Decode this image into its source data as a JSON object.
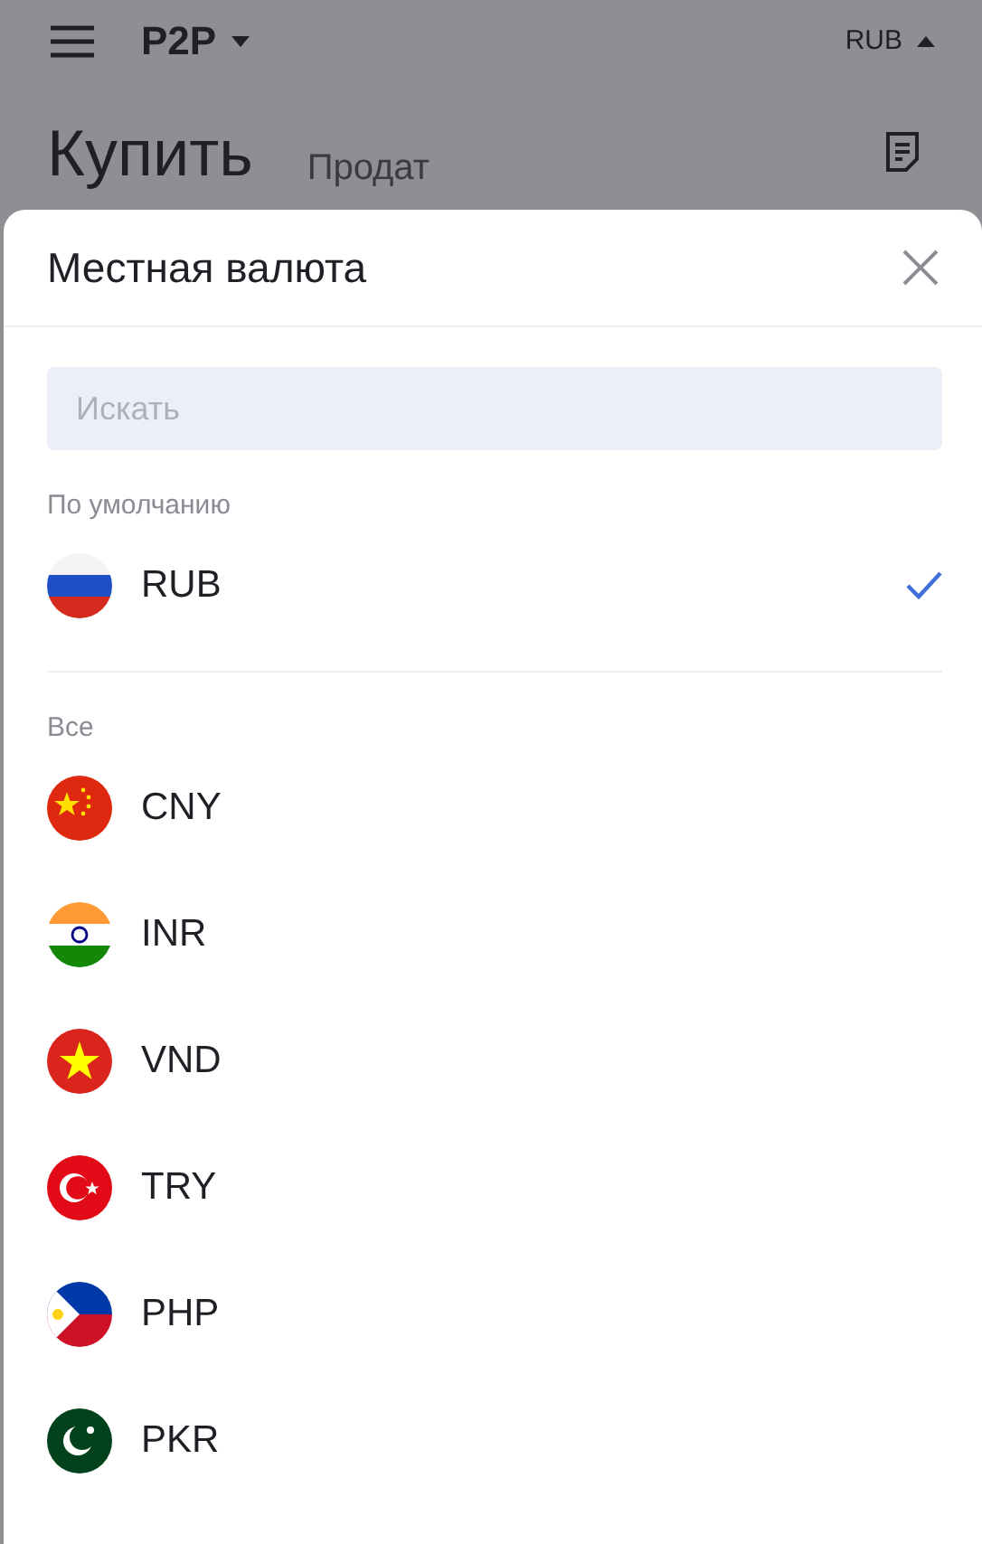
{
  "top_bar": {
    "title": "P2P",
    "currency": "RUB"
  },
  "page": {
    "tabs": [
      {
        "label": "Купить",
        "selected": true
      },
      {
        "label": "Продат",
        "selected": false
      }
    ]
  },
  "sheet": {
    "title": "Местная валюта",
    "search": {
      "placeholder": "Искать"
    },
    "sections": [
      {
        "title": "По умолчанию",
        "items": [
          {
            "code": "RUB",
            "kind": "russia",
            "selected": true
          }
        ]
      },
      {
        "title": "Все",
        "items": [
          {
            "code": "CNY",
            "kind": "china",
            "selected": false
          },
          {
            "code": "INR",
            "kind": "india",
            "selected": false
          },
          {
            "code": "VND",
            "kind": "vietnam",
            "selected": false
          },
          {
            "code": "TRY",
            "kind": "turkey",
            "selected": false
          },
          {
            "code": "PHP",
            "kind": "philippines",
            "selected": false
          },
          {
            "code": "PKR",
            "kind": "pakistan",
            "selected": false
          }
        ]
      }
    ]
  }
}
